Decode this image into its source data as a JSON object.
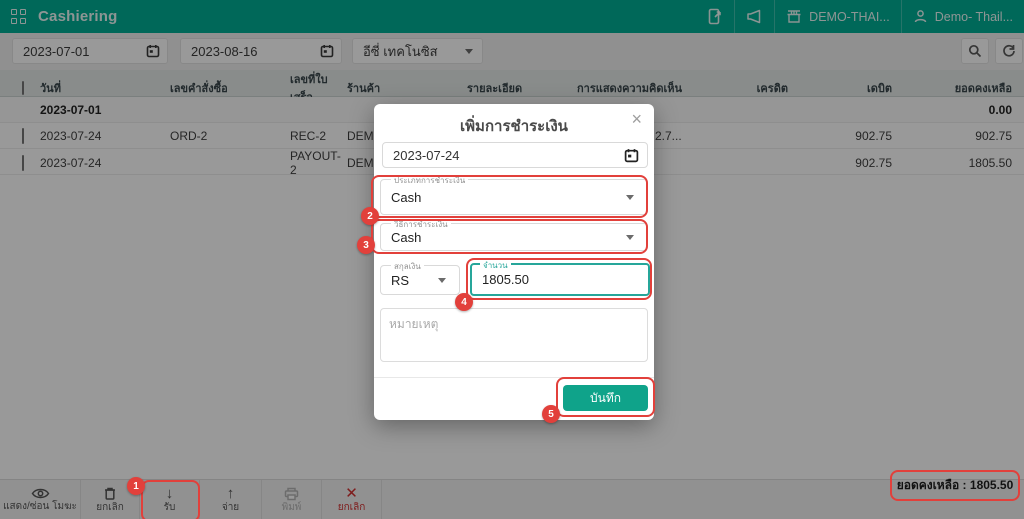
{
  "appbar": {
    "title": "Cashiering",
    "store_button": "DEMO-THAI...",
    "user_button": "Demo- Thail..."
  },
  "filters": {
    "date_from": "2023-07-01",
    "date_to": "2023-08-16",
    "merchant_selected": "อีซี่ เทคโนซิส"
  },
  "table": {
    "headers": {
      "date": "วันที่",
      "order_no": "เลขคำสั่งซื้อ",
      "receipt_no": "เลขที่ใบเสร็จ",
      "store": "ร้านค้า",
      "details": "รายละเอียด",
      "comment": "การแสดงความคิดเห็น",
      "credit": "เครดิต",
      "debit": "เดบิต",
      "balance": "ยอดคงเหลือ"
    },
    "rows": [
      {
        "date": "2023-07-01",
        "order_no": "",
        "receipt_no": "",
        "store": "",
        "comment": "",
        "credit": "",
        "debit": "",
        "balance": "0.00"
      },
      {
        "date": "2023-07-24",
        "order_no": "ORD-2",
        "receipt_no": "REC-2",
        "store": "DEMO",
        "comment": "2.7...",
        "credit": "",
        "debit": "902.75",
        "balance": "902.75"
      },
      {
        "date": "2023-07-24",
        "order_no": "",
        "receipt_no": "PAYOUT-2",
        "store": "DEMO",
        "comment": "",
        "credit": "",
        "debit": "902.75",
        "balance": "1805.50"
      }
    ]
  },
  "toolbar": {
    "show_hide_void": "แสดง/ซ่อน โมฆะ",
    "void_label": "ยกเลิก",
    "receive": "รับ",
    "pay": "จ่าย",
    "print": "พิมพ์",
    "cancel": "ยกเลิก",
    "receive_glyph": "↓",
    "pay_glyph": "↑",
    "cancel_glyph": "✕",
    "balance_summary": "ยอดคงเหลือ : 1805.50"
  },
  "modal": {
    "title": "เพิ่มการชำระเงิน",
    "close_glyph": "×",
    "date_value": "2023-07-24",
    "payment_type": {
      "label": "ประเภทการชำระเงิน",
      "value": "Cash"
    },
    "payment_method": {
      "label": "วิธีการชำระเงิน",
      "value": "Cash"
    },
    "currency": {
      "label": "สกุลเงิน",
      "value": "RS"
    },
    "amount": {
      "label": "จำนวน",
      "value": "1805.50"
    },
    "note_placeholder": "หมายเหตุ",
    "save": "บันทึก"
  },
  "annotations": {
    "step1": "1",
    "step2": "2",
    "step3": "3",
    "step4": "4",
    "step5": "5"
  },
  "colors": {
    "brand_teal": "#00AD94",
    "focus_teal": "#26A69A",
    "save_button_teal": "#0FA38A",
    "annotation_red": "#E2403B",
    "cancel_red": "#D32F2F"
  }
}
